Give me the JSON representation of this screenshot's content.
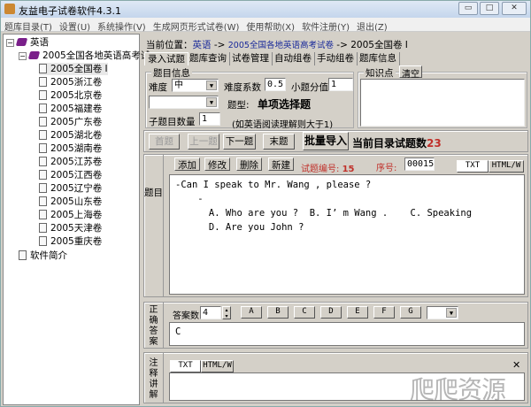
{
  "window": {
    "title": "友益电子试卷软件4.3.1",
    "minimize": "▭",
    "maximize": "□",
    "close": "✕"
  },
  "menu": [
    "题库目录(T)",
    "设置(U)",
    "系统操作(V)",
    "生成网页形式试卷(W)",
    "使用帮助(X)",
    "软件注册(Y)",
    "退出(Z)"
  ],
  "tree": {
    "root": "英语",
    "child": "2005全国各地英语高考试",
    "items": [
      "2005全国卷 I",
      "2005浙江卷",
      "2005北京卷",
      "2005福建卷",
      "2005广东卷",
      "2005湖北卷",
      "2005湖南卷",
      "2005江苏卷",
      "2005江西卷",
      "2005辽宁卷",
      "2005山东卷",
      "2005上海卷",
      "2005天津卷",
      "2005重庆卷"
    ],
    "extra": "软件简介"
  },
  "breadcrumb": {
    "label": "当前位置：",
    "path1": "英语",
    "sep": " -> ",
    "path2": "2005全国各地英语高考试卷",
    "path3": "2005全国卷 I"
  },
  "tabs": [
    "录入试题",
    "题库查询",
    "试卷管理",
    "自动组卷",
    "手动组卷",
    "题库信息"
  ],
  "info": {
    "title": "题目信息",
    "difficulty_label": "难度",
    "difficulty": "中",
    "coef_label": "难度系数",
    "coef": "0.5",
    "score_label": "小题分值",
    "score": "1",
    "type_label": "题型:",
    "type": "单项选择题",
    "sub_label": "子题目数量",
    "sub": "1",
    "sub_note": "(如英语阅读理解则大于1)"
  },
  "knowledge": {
    "title": "知识点",
    "clear": "清空"
  },
  "nav": {
    "first": "首题",
    "prev": "上一题",
    "next": "下一题",
    "last": "末题",
    "import": "批量导入",
    "count_label": "当前目录试题数",
    "count": "23"
  },
  "question": {
    "label": "题目",
    "add": "添加",
    "edit": "修改",
    "delete": "删除",
    "new": "新建",
    "id_label": "试题编号:",
    "id": "15",
    "seq_label": "序号:",
    "seq": "00015",
    "txt": "TXT",
    "html": "HTML/W",
    "text": "-Can I speak to Mr. Wang , please ?\n    -\n      A. Who are you ?  B. I’ m Wang .    C. Speaking\n      D. Are you John ?"
  },
  "answer": {
    "label": "正确答案",
    "count_label": "答案数",
    "count": "4",
    "options": [
      "A",
      "B",
      "C",
      "D",
      "E",
      "F",
      "G"
    ],
    "value": "C"
  },
  "notes": {
    "label": "注释讲解",
    "txt": "TXT",
    "html": "HTML/W",
    "close": "✕",
    "text": ""
  },
  "watermark": "爬爬资源"
}
